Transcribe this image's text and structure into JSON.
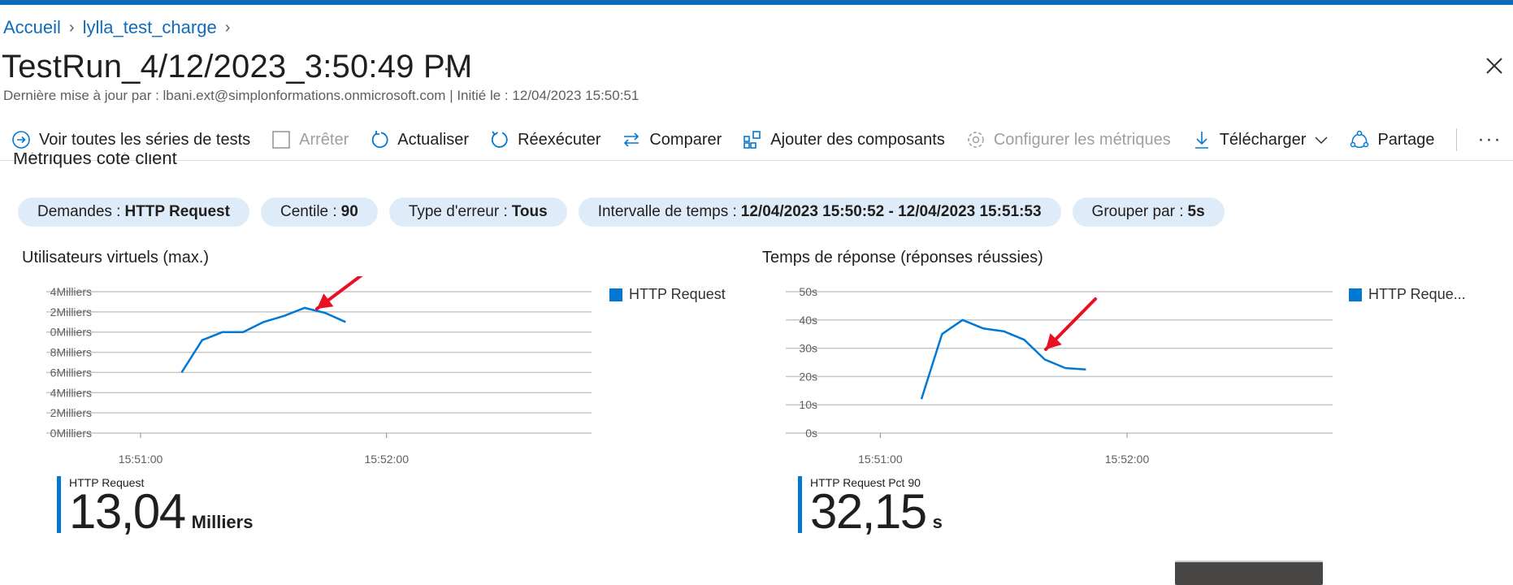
{
  "breadcrumb": {
    "home": "Accueil",
    "resource": "lylla_test_charge"
  },
  "page": {
    "title": "TestRun_4/12/2023_3:50:49 PM",
    "more": "···",
    "subtitle": "Dernière mise à jour par : lbani.ext@simplonformations.onmicrosoft.com | Initié le : 12/04/2023 15:50:51"
  },
  "toolbar": {
    "view_all": "Voir toutes les séries de tests",
    "stop": "Arrêter",
    "refresh": "Actualiser",
    "rerun": "Réexécuter",
    "compare": "Comparer",
    "add_components": "Ajouter des composants",
    "configure_metrics": "Configurer les métriques",
    "download": "Télécharger",
    "share": "Partage",
    "more": "···"
  },
  "section": {
    "title": "Métriques coté client"
  },
  "filters": [
    {
      "label": "Demandes :",
      "value": "HTTP Request"
    },
    {
      "label": "Centile :",
      "value": "90"
    },
    {
      "label": "Type d'erreur :",
      "value": "Tous"
    },
    {
      "label": "Intervalle de temps :",
      "value": "12/04/2023 15:50:52 - 12/04/2023 15:51:53"
    },
    {
      "label": "Grouper par :",
      "value": "5s"
    }
  ],
  "colors": {
    "accent": "#0078d4",
    "pill_bg": "#deecf9",
    "arrow": "#e81123"
  },
  "chart_data": [
    {
      "type": "line",
      "title": "Utilisateurs virtuels (max.)",
      "y_ticks": [
        "4Milliers",
        "2Milliers",
        "0Milliers",
        "8Milliers",
        "6Milliers",
        "4Milliers",
        "2Milliers",
        "0Milliers"
      ],
      "y_tick_values": [
        14,
        12,
        10,
        8,
        6,
        4,
        2,
        0
      ],
      "ylim": [
        0,
        14
      ],
      "x_ticks": [
        "15:51:00",
        "15:52:00"
      ],
      "x_tick_seconds": [
        60,
        120
      ],
      "xlim": [
        37,
        170
      ],
      "x_unit": "seconds after 15:50:00",
      "legend": [
        "HTTP Request"
      ],
      "series": [
        {
          "name": "HTTP Request",
          "x": [
            70,
            75,
            80,
            85,
            90,
            95,
            100,
            105,
            110
          ],
          "values": [
            6,
            9.2,
            10,
            10,
            11,
            11.6,
            12.4,
            11.9,
            11
          ]
        }
      ],
      "summary": {
        "label": "HTTP Request",
        "value": "13,04",
        "unit": "Milliers"
      }
    },
    {
      "type": "line",
      "title": "Temps de réponse (réponses réussies)",
      "y_ticks": [
        "50s",
        "40s",
        "30s",
        "20s",
        "10s",
        "0s"
      ],
      "y_tick_values": [
        50,
        40,
        30,
        20,
        10,
        0
      ],
      "ylim": [
        0,
        50
      ],
      "x_ticks": [
        "15:51:00",
        "15:52:00"
      ],
      "x_tick_seconds": [
        60,
        120
      ],
      "xlim": [
        37,
        170
      ],
      "x_unit": "seconds after 15:50:00",
      "legend": [
        "HTTP Reque..."
      ],
      "series": [
        {
          "name": "HTTP Reque...",
          "x": [
            70,
            75,
            80,
            85,
            90,
            95,
            100,
            105,
            110
          ],
          "values": [
            12,
            35,
            40,
            37,
            36,
            33,
            26,
            23,
            22.5
          ]
        }
      ],
      "summary": {
        "label": "HTTP Request Pct 90",
        "value": "32,15",
        "unit": "s"
      }
    }
  ]
}
